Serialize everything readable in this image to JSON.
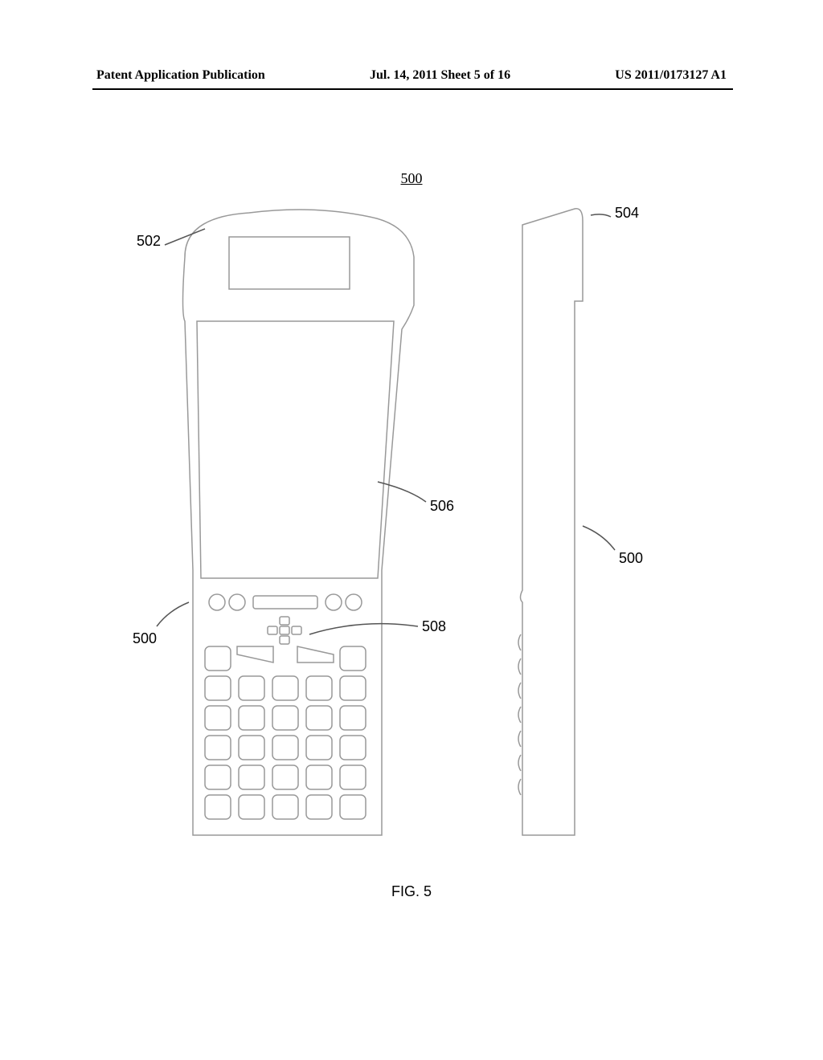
{
  "header": {
    "left": "Patent Application Publication",
    "center": "Jul. 14, 2011  Sheet 5 of 16",
    "right": "US 2011/0173127 A1"
  },
  "figure": {
    "title": "500",
    "caption": "FIG. 5",
    "refs": {
      "r500_left": "500",
      "r500_right": "500",
      "r502": "502",
      "r504": "504",
      "r506": "506",
      "r508": "508"
    }
  }
}
